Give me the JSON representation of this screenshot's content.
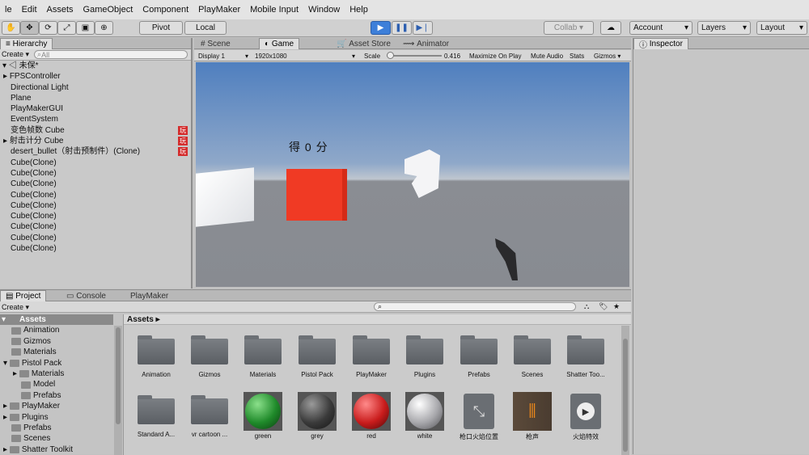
{
  "menu": [
    "le",
    "Edit",
    "Assets",
    "GameObject",
    "Component",
    "PlayMaker",
    "Mobile Input",
    "Window",
    "Help"
  ],
  "toolbar": {
    "pivot": "Pivot",
    "local": "Local",
    "collab": "Collab",
    "account": "Account",
    "layers": "Layers",
    "layout": "Layout"
  },
  "hierarchy": {
    "tab": "Hierarchy",
    "create": "Create",
    "search": "All",
    "scene": "未保*",
    "items": [
      "FPSController",
      "Directional Light",
      "Plane",
      "PlayMakerGUI",
      "EventSystem",
      "变色帧数 Cube",
      "射击计分 Cube",
      "desert_bullet（射击预制件）(Clone)",
      "Cube(Clone)",
      "Cube(Clone)",
      "Cube(Clone)",
      "Cube(Clone)",
      "Cube(Clone)",
      "Cube(Clone)",
      "Cube(Clone)",
      "Cube(Clone)",
      "Cube(Clone)"
    ],
    "badge": "玩"
  },
  "center_tabs": {
    "scene": "Scene",
    "game": "Game",
    "store": "Asset Store",
    "animator": "Animator"
  },
  "game_bar": {
    "display": "Display 1",
    "resolution": "1920x1080",
    "scale_label": "Scale",
    "scale_value": "0.416",
    "maximize": "Maximize On Play",
    "mute": "Mute Audio",
    "stats": "Stats",
    "gizmos": "Gizmos"
  },
  "game_view": {
    "score_text": "得  0  分"
  },
  "inspector": {
    "tab": "Inspector"
  },
  "project": {
    "tab": "Project",
    "console": "Console",
    "playmaker": "PlayMaker",
    "create": "Create",
    "breadcrumb": "Assets",
    "tree": [
      "Assets",
      "Animation",
      "Gizmos",
      "Materials",
      "Pistol Pack",
      "Materials",
      "Model",
      "Prefabs",
      "PlayMaker",
      "Plugins",
      "Prefabs",
      "Scenes",
      "Shatter Toolkit"
    ],
    "assets_row1": [
      "Animation",
      "Gizmos",
      "Materials",
      "Pistol Pack",
      "PlayMaker",
      "Plugins",
      "Prefabs",
      "Scenes",
      "Shatter Too..."
    ],
    "assets_row2": [
      "Standard A...",
      "vr cartoon ...",
      "green",
      "grey",
      "red",
      "white",
      "枪口火焰位置",
      "枪声",
      "火焰特效"
    ]
  },
  "colors": {
    "accent": "#3d7fd9",
    "red_cube": "#f03a24",
    "badge": "#d42d2d"
  }
}
